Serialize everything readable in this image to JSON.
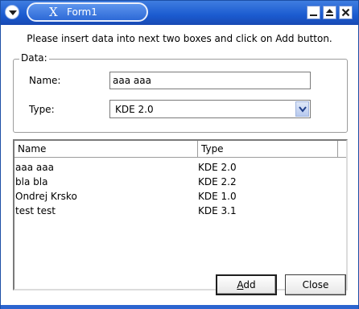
{
  "window": {
    "title": "Form1",
    "x_logo": "X"
  },
  "instruction": "Please insert data into next two boxes and click on Add button.",
  "group": {
    "legend": "Data:",
    "name_label": "Name:",
    "name_value": "aaa aaa",
    "type_label": "Type:",
    "type_value": "KDE 2.0"
  },
  "list": {
    "columns": [
      "Name",
      "Type"
    ],
    "rows": [
      {
        "name": "aaa aaa",
        "type": "KDE 2.0"
      },
      {
        "name": "bla bla",
        "type": "KDE 2.2"
      },
      {
        "name": "Ondrej Krsko",
        "type": "KDE 1.0"
      },
      {
        "name": "test test",
        "type": "KDE 3.1"
      }
    ]
  },
  "buttons": {
    "add_label": "Add",
    "add_mnemonic": "A",
    "add_rest": "dd",
    "close_label": "Close"
  },
  "icons": {
    "window_menu": "chevron-down-icon",
    "minimize": "minimize-icon",
    "shade": "shade-icon",
    "close": "close-icon",
    "combo_arrow": "chevron-down-icon"
  },
  "colors": {
    "titlebar": "#1b5bd0",
    "title_text": "#ffffff",
    "border": "#7a7a7a"
  }
}
